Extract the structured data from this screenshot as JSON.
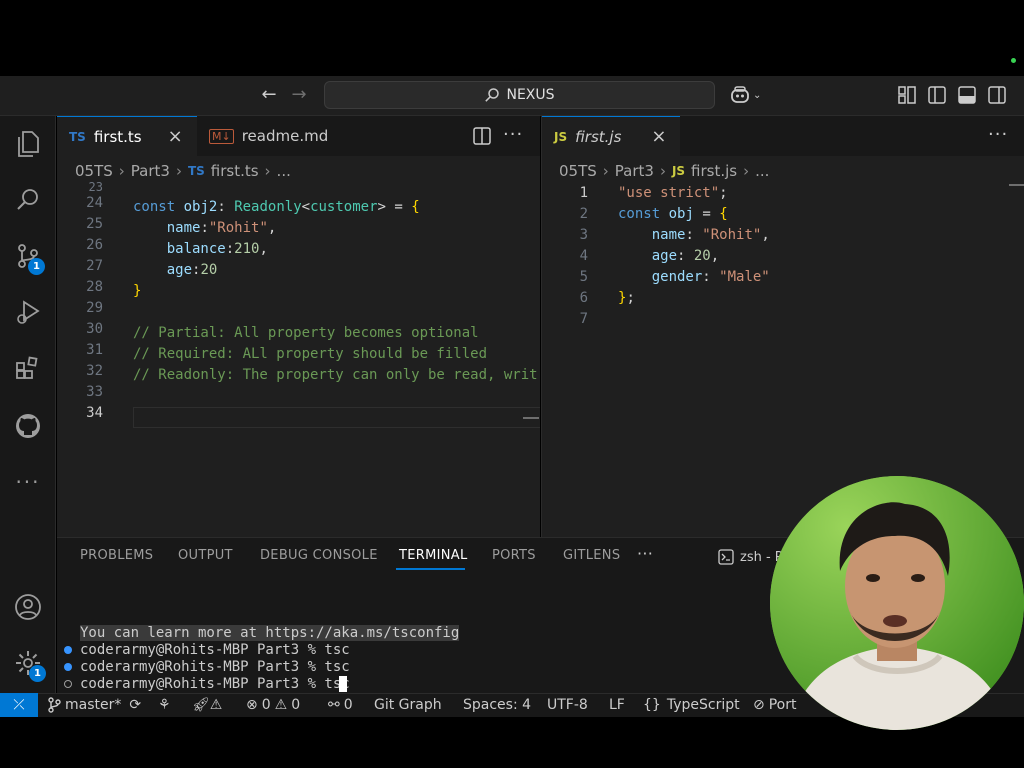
{
  "titlebar": {
    "search_text": "NEXUS"
  },
  "activity": {
    "scm_badge": "1",
    "settings_badge": "1"
  },
  "left_editor": {
    "tabs": [
      {
        "badge": "TS",
        "label": "first.ts"
      },
      {
        "badge": "M↓",
        "label": "readme.md"
      }
    ],
    "breadcrumb": [
      "05TS",
      "Part3",
      "first.ts",
      "..."
    ],
    "breadcrumb_badge": "TS",
    "line_numbers": [
      "23",
      "24",
      "25",
      "26",
      "27",
      "28",
      "29",
      "30",
      "31",
      "32",
      "33",
      "34"
    ],
    "code": {
      "l24_kw": "const",
      "l24_var": "obj2",
      "l24_colon": ":",
      "l24_type": "Readonly",
      "l24_lt": "<",
      "l24_generic": "customer",
      "l24_gt": ">",
      "l24_eq": " = ",
      "l24_brace": "{",
      "l25_key": "name",
      "l25_colon": ":",
      "l25_val": "\"Rohit\"",
      "l25_comma": ",",
      "l26_key": "balance",
      "l26_colon": ":",
      "l26_val": "210",
      "l26_comma": ",",
      "l27_key": "age",
      "l27_colon": ":",
      "l27_val": "20",
      "l28_brace": "}",
      "l30": "// Partial: All property becomes optional",
      "l31": "// Required: ALl property should be filled",
      "l32": "// Readonly: The property can only be read, writ"
    }
  },
  "right_editor": {
    "tab": {
      "badge": "JS",
      "label": "first.js"
    },
    "breadcrumb": [
      "05TS",
      "Part3",
      "first.js",
      "..."
    ],
    "breadcrumb_badge": "JS",
    "line_numbers": [
      "1",
      "2",
      "3",
      "4",
      "5",
      "6",
      "7"
    ],
    "code": {
      "l1_str": "\"use strict\"",
      "l1_semi": ";",
      "l2_kw": "const",
      "l2_var": "obj",
      "l2_eq": " = ",
      "l2_brace": "{",
      "l3_key": "name",
      "l3_colon": ": ",
      "l3_val": "\"Rohit\"",
      "l3_comma": ",",
      "l4_key": "age",
      "l4_colon": ": ",
      "l4_val": "20",
      "l4_comma": ",",
      "l5_key": "gender",
      "l5_colon": ": ",
      "l5_val": "\"Male\"",
      "l6_brace": "}",
      "l6_semi": ";"
    }
  },
  "panel": {
    "tabs": [
      "PROBLEMS",
      "OUTPUT",
      "DEBUG CONSOLE",
      "TERMINAL",
      "PORTS",
      "GITLENS"
    ],
    "more": "···",
    "shell": "zsh - P",
    "terminal_lines": [
      "You can learn more at https://aka.ms/tsconfig",
      "coderarmy@Rohits-MBP Part3 % tsc",
      "coderarmy@Rohits-MBP Part3 % tsc",
      "coderarmy@Rohits-MBP Part3 % tsc"
    ]
  },
  "statusbar": {
    "branch": "master*",
    "errors": "0",
    "warnings": "0",
    "ports": "0",
    "git_graph": "Git Graph",
    "spaces": "Spaces: 4",
    "encoding": "UTF-8",
    "eol": "LF",
    "language": "TypeScript",
    "port": "Port"
  },
  "colors": {
    "accent": "#0078d4",
    "editor_bg": "#1f1f1f",
    "sidebar_bg": "#181818"
  }
}
